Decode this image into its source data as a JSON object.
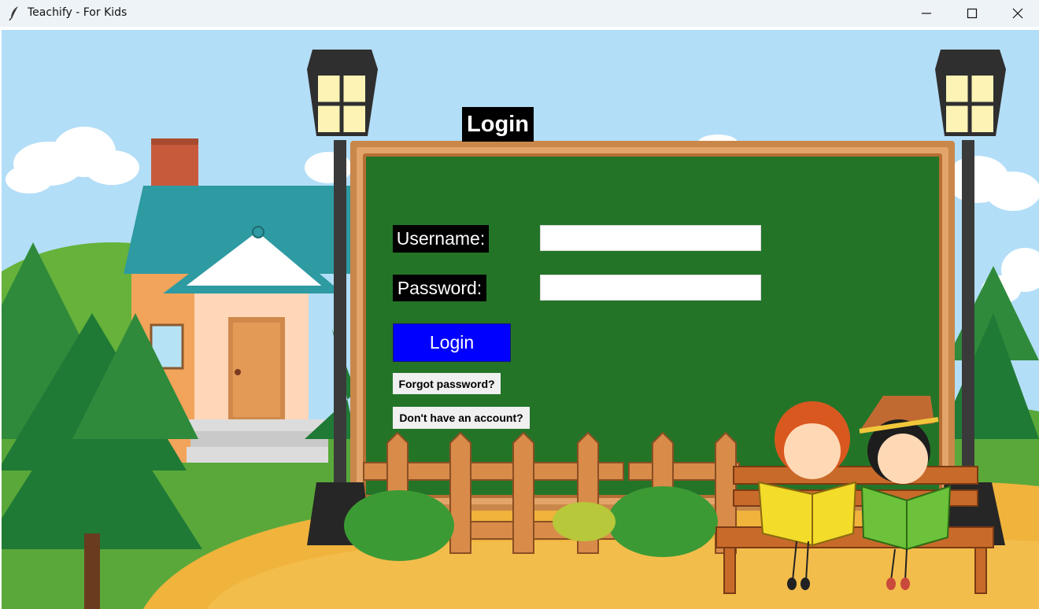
{
  "window": {
    "title": "Teachify - For Kids",
    "icon": "feather-icon"
  },
  "login": {
    "heading": "Login",
    "username_label": "Username:",
    "password_label": "Password:",
    "username_value": "",
    "password_value": "",
    "login_button": "Login",
    "forgot_password": "Forgot password?",
    "signup_link": "Don't have an account?"
  },
  "colors": {
    "sky": "#b3def7",
    "chalkboard": "#247428",
    "board_frame": "#c9874a",
    "login_button": "#0000ff",
    "label_bg": "#000000"
  }
}
